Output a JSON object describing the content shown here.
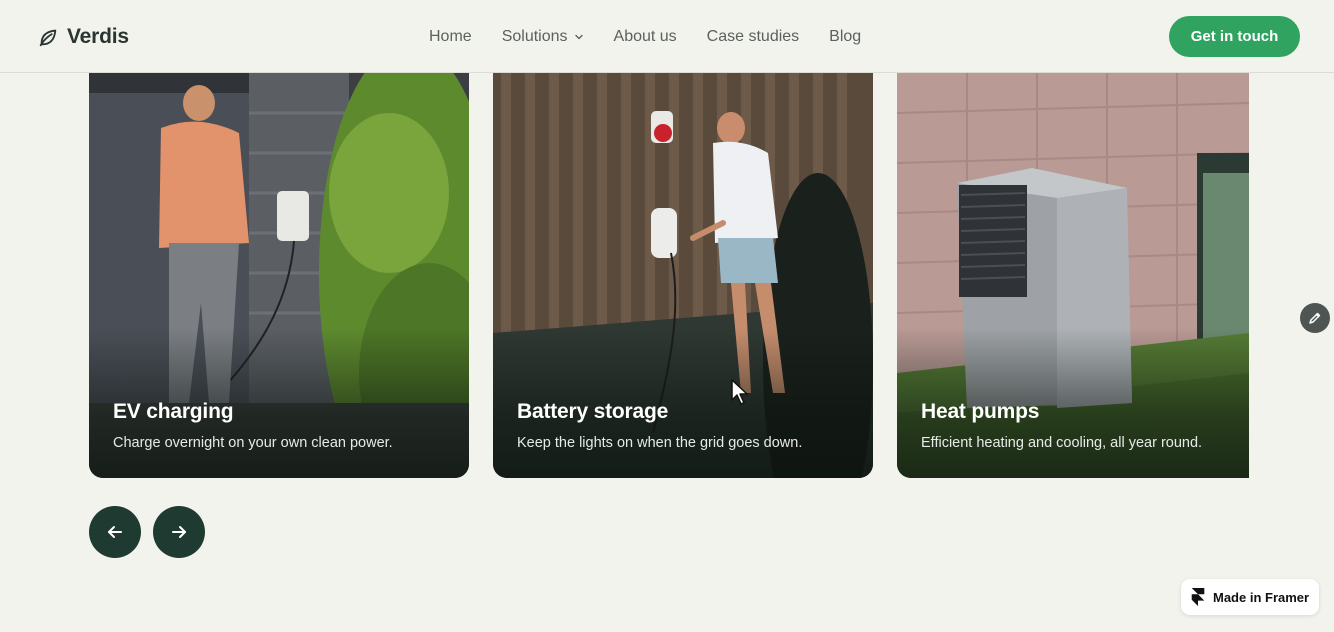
{
  "brand": {
    "name": "Verdis",
    "logo_icon": "leaf-icon"
  },
  "nav": {
    "items": [
      {
        "label": "Home"
      },
      {
        "label": "Solutions",
        "has_dropdown": true
      },
      {
        "label": "About us"
      },
      {
        "label": "Case studies"
      },
      {
        "label": "Blog"
      }
    ]
  },
  "cta": {
    "label": "Get in touch"
  },
  "cards": [
    {
      "title": "EV charging",
      "description": "Charge overnight on your own clean power."
    },
    {
      "title": "Battery storage",
      "description": "Keep the lights on when the grid goes down."
    },
    {
      "title": "Heat pumps",
      "description": "Efficient heating and cooling, all year round."
    }
  ],
  "carousel": {
    "prev_icon": "arrow-left-icon",
    "next_icon": "arrow-right-icon"
  },
  "edit_button": {
    "icon": "pencil-icon"
  },
  "badge": {
    "label": "Made in Framer",
    "icon": "framer-icon"
  },
  "colors": {
    "background": "#f3f3ee",
    "accent": "#2fa35f",
    "arrow_bg": "#1f3a30",
    "text_nav": "#5a625e"
  }
}
